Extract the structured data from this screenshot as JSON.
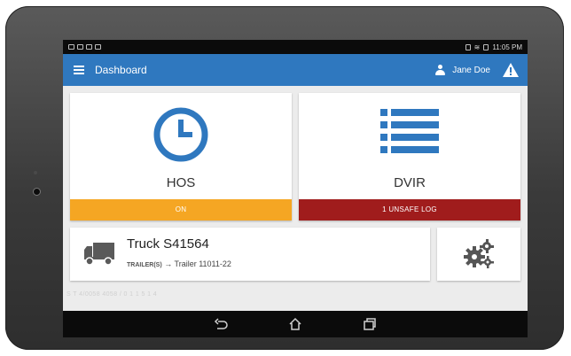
{
  "status_bar": {
    "time": "11:05 PM"
  },
  "app_bar": {
    "title": "Dashboard",
    "user_name": "Jane Doe",
    "alert_icon": "warning-triangle-icon"
  },
  "tiles": {
    "hos": {
      "label": "HOS",
      "status": "ON",
      "status_color": "#f5a623",
      "icon": "clock-icon"
    },
    "dvir": {
      "label": "DVIR",
      "status": "1 UNSAFE LOG",
      "status_color": "#a01c1c",
      "icon": "list-icon"
    }
  },
  "truck": {
    "title": "Truck S41564",
    "trailer_prefix": "TRAILER(S)",
    "trailer_arrow": "→",
    "trailer_value": "Trailer 11011-22",
    "icon": "truck-icon"
  },
  "settings": {
    "icon": "gears-icon"
  },
  "footer": {
    "text": "S T 4/0058 4058 / 0 1 1 5 1 4"
  },
  "nav_bar": {
    "back_icon": "back-icon",
    "home_icon": "home-icon",
    "recents_icon": "recents-icon"
  },
  "colors": {
    "primary": "#2f78bf",
    "hos_on": "#f5a623",
    "unsafe": "#a01c1c"
  }
}
